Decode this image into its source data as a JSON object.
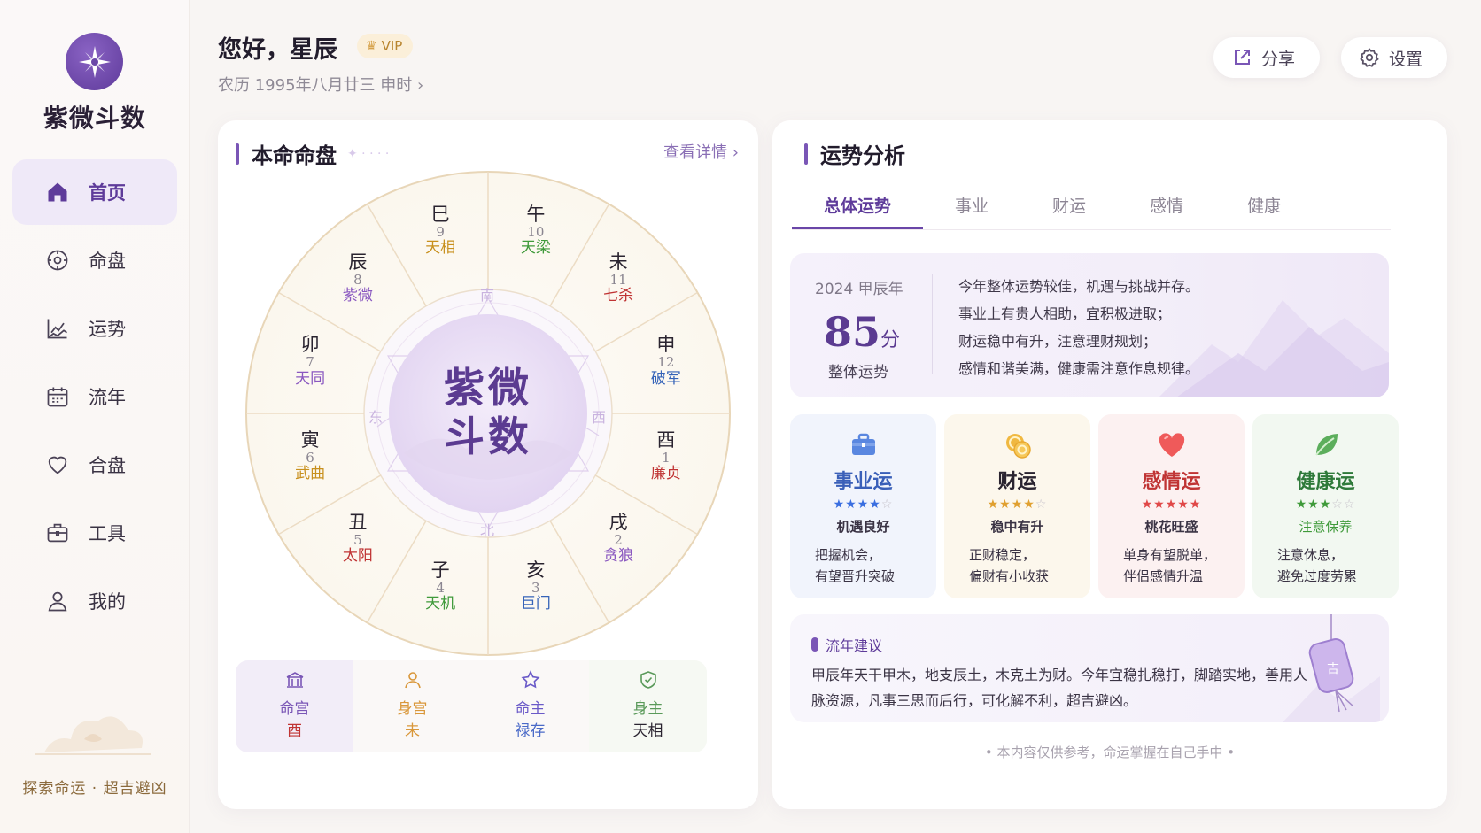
{
  "brand": {
    "title": "紫微斗数",
    "slogan": "探索命运 · 超吉避凶"
  },
  "nav": [
    {
      "label": "首页",
      "icon": "home-icon"
    },
    {
      "label": "命盘",
      "icon": "compass-icon"
    },
    {
      "label": "运势",
      "icon": "chart-icon"
    },
    {
      "label": "流年",
      "icon": "calendar-icon"
    },
    {
      "label": "合盘",
      "icon": "heart-icon"
    },
    {
      "label": "工具",
      "icon": "toolbox-icon"
    },
    {
      "label": "我的",
      "icon": "user-icon"
    }
  ],
  "header": {
    "greeting": "您好，星辰",
    "vip": "VIP",
    "lunar": "农历 1995年八月廿三  申时",
    "share": "分享",
    "settings": "设置"
  },
  "chart_card": {
    "title": "本命命盘",
    "more": "查看详情",
    "center_line1": "紫微",
    "center_line2": "斗数",
    "directions": {
      "south": "南",
      "east": "东",
      "west": "西",
      "north": "北"
    },
    "palaces": [
      {
        "branch": "巳",
        "num": "9",
        "star": "天相",
        "color": "#c8901e"
      },
      {
        "branch": "午",
        "num": "10",
        "star": "天梁",
        "color": "#3f9a3a"
      },
      {
        "branch": "未",
        "num": "11",
        "star": "七杀",
        "color": "#c03434"
      },
      {
        "branch": "申",
        "num": "12",
        "star": "破军",
        "color": "#3563b8"
      },
      {
        "branch": "酉",
        "num": "1",
        "star": "廉贞",
        "color": "#c03434"
      },
      {
        "branch": "戌",
        "num": "2",
        "star": "贪狼",
        "color": "#8a58c0"
      },
      {
        "branch": "亥",
        "num": "3",
        "star": "巨门",
        "color": "#3563b8"
      },
      {
        "branch": "子",
        "num": "4",
        "star": "天机",
        "color": "#3f9a3a"
      },
      {
        "branch": "丑",
        "num": "5",
        "star": "太阳",
        "color": "#c03434"
      },
      {
        "branch": "寅",
        "num": "6",
        "star": "武曲",
        "color": "#c8901e"
      },
      {
        "branch": "卯",
        "num": "7",
        "star": "天同",
        "color": "#8a58c0"
      },
      {
        "branch": "辰",
        "num": "8",
        "star": "紫微",
        "color": "#8a58c0"
      }
    ],
    "info": [
      {
        "label": "命宫",
        "value": "酉",
        "icon": "palace-icon",
        "color": "#7a56b6",
        "vcolor": "#c03434"
      },
      {
        "label": "身宫",
        "value": "未",
        "icon": "person-icon",
        "color": "#d9973a",
        "vcolor": "#d9973a"
      },
      {
        "label": "命主",
        "value": "禄存",
        "icon": "star-icon",
        "color": "#6a5ac8",
        "vcolor": "#4a6ac8"
      },
      {
        "label": "身主",
        "value": "天相",
        "icon": "shield-icon",
        "color": "#5a9a5a",
        "vcolor": "#2a2430"
      }
    ]
  },
  "analysis": {
    "title": "运势分析",
    "tabs": [
      "总体运势",
      "事业",
      "财运",
      "感情",
      "健康"
    ],
    "overall": {
      "year": "2024 甲辰年",
      "score": "85",
      "unit": "分",
      "label": "整体运势",
      "lines": [
        "今年整体运势较佳，机遇与挑战并存。",
        "事业上有贵人相助，宜积极进取；",
        "财运稳中有升，注意理财规划；",
        "感情和谐美满，健康需注意作息规律。"
      ]
    },
    "cards": [
      {
        "name": "事业运",
        "rating": 4,
        "tag": "机遇良好",
        "d1": "把握机会，",
        "d2": "有望晋升突破",
        "color": "#3a5fb8",
        "star": "#3a6ee0",
        "bg": "#f1f4fc",
        "icon": "briefcase-icon"
      },
      {
        "name": "财运",
        "rating": 4,
        "tag": "稳中有升",
        "d1": "正财稳定，",
        "d2": "偏财有小收获",
        "color": "#2a2430",
        "star": "#e0a030",
        "bg": "#fcf7ec",
        "icon": "coins-icon"
      },
      {
        "name": "感情运",
        "rating": 5,
        "tag": "桃花旺盛",
        "d1": "单身有望脱单，",
        "d2": "伴侣感情升温",
        "color": "#c03434",
        "star": "#e04848",
        "bg": "#fcf1f1",
        "icon": "heart-icon"
      },
      {
        "name": "健康运",
        "rating": 3,
        "tag": "注意保养",
        "d1": "注意休息，",
        "d2": "避免过度劳累",
        "color": "#2f7a3a",
        "star": "#3f9a3a",
        "bg": "#f2f8f1",
        "icon": "leaf-icon"
      }
    ],
    "advice": {
      "title": "流年建议",
      "text": "甲辰年天干甲木，地支辰土，木克土为财。今年宜稳扎稳打，脚踏实地，善用人脉资源，凡事三思而后行，可化解不利，超吉避凶。"
    },
    "footer": "• 本内容仅供参考，命运掌握在自己手中 •"
  }
}
